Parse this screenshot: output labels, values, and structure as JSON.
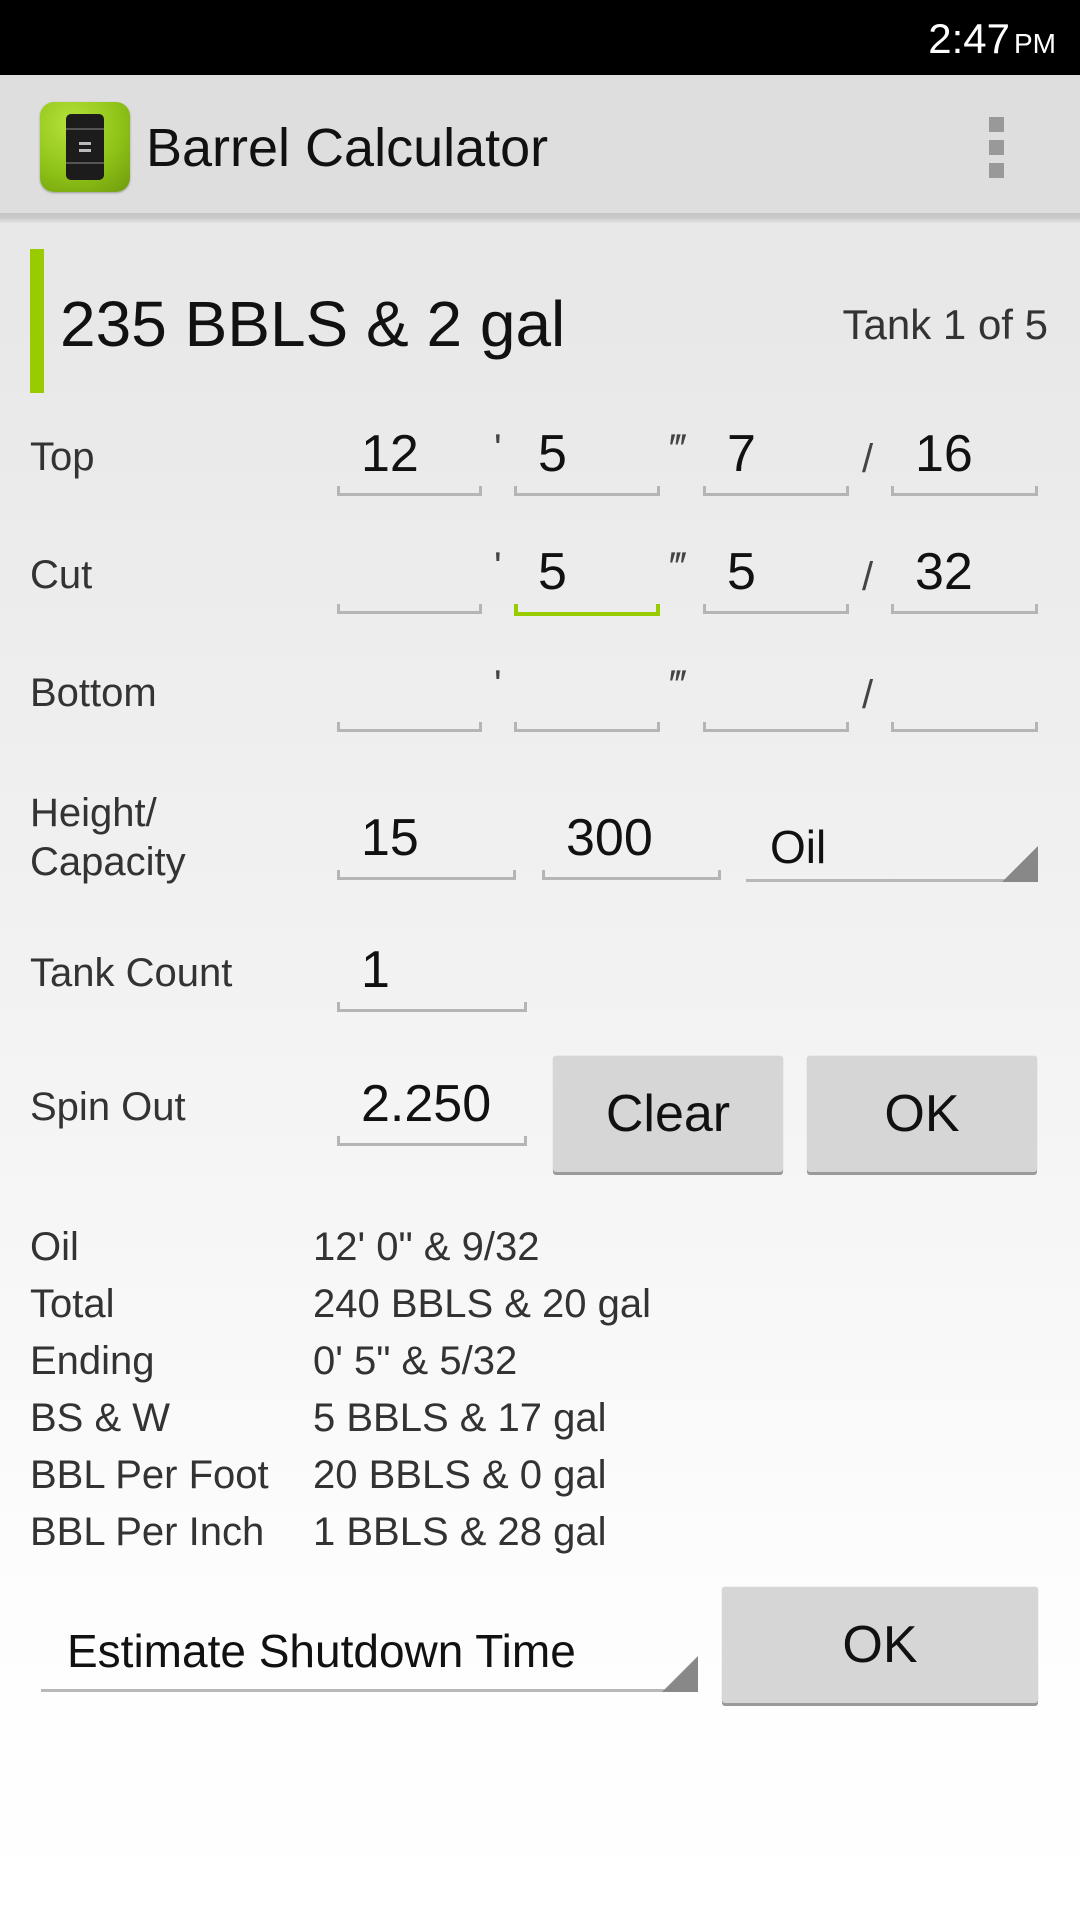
{
  "status_bar": {
    "time": "2:47",
    "ampm": "PM"
  },
  "app": {
    "title": "Barrel Calculator",
    "icon": "oil-barrel-icon",
    "menu_icon": "overflow-menu-icon"
  },
  "accent_color": "#99cc00",
  "summary": {
    "result": "235 BBLS & 2 gal",
    "tank_indicator": "Tank 1 of 5"
  },
  "separators": {
    "feet": "'",
    "inches": "‴",
    "fraction": "/"
  },
  "measurements": [
    {
      "label": "Top",
      "feet": "12",
      "inches": "5",
      "numerator": "7",
      "denominator": "16"
    },
    {
      "label": "Cut",
      "feet": "",
      "inches": "5",
      "numerator": "5",
      "denominator": "32"
    },
    {
      "label": "Bottom",
      "feet": "",
      "inches": "",
      "numerator": "",
      "denominator": ""
    }
  ],
  "height_capacity": {
    "label_line1": "Height/",
    "label_line2": "Capacity",
    "height": "15",
    "capacity": "300",
    "fluid_type": "Oil"
  },
  "tank_count": {
    "label": "Tank Count",
    "value": "1"
  },
  "spin_out": {
    "label": "Spin Out",
    "value": "2.250",
    "clear_label": "Clear",
    "ok_label": "OK"
  },
  "results": [
    {
      "label": "Oil",
      "value": "12' 0\" & 9/32"
    },
    {
      "label": "Total",
      "value": "240 BBLS & 20 gal"
    },
    {
      "label": "Ending",
      "value": "0' 5\" & 5/32"
    },
    {
      "label": "BS & W",
      "value": "5 BBLS & 17 gal"
    },
    {
      "label": "BBL Per Foot",
      "value": "20 BBLS & 0 gal"
    },
    {
      "label": "BBL Per Inch",
      "value": "1 BBLS & 28 gal"
    }
  ],
  "estimate": {
    "selected": "Estimate Shutdown Time",
    "ok_label": "OK"
  }
}
